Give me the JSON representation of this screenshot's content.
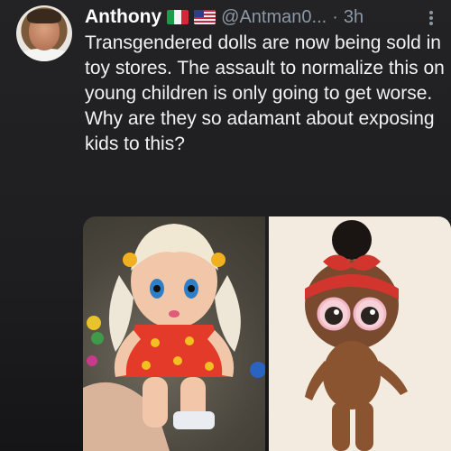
{
  "tweet": {
    "author": {
      "name": "Anthony",
      "flags": [
        "italy-flag-icon",
        "usa-flag-icon"
      ],
      "handle": "@Antman0...",
      "separator": "·",
      "time": "3h"
    },
    "text": "Transgendered dolls are now being sold in toy stores. The assault to normalize this on young children is only going to get worse. Why are they so adamant about exposing kids to this?",
    "media": [
      {
        "name": "doll-photo-blonde-pigtails"
      },
      {
        "name": "doll-photo-lol-doll"
      }
    ]
  },
  "colors": {
    "background": "#1c1c1e",
    "text": "#f2f2f2",
    "secondary_text": "#8b98a5"
  }
}
